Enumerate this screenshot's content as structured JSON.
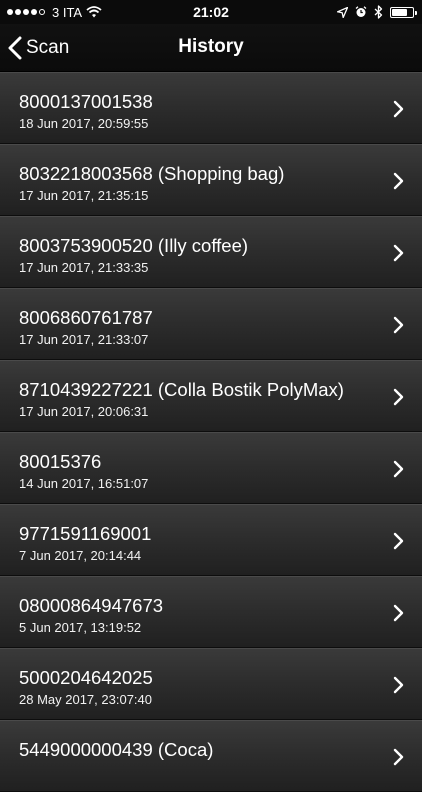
{
  "status_bar": {
    "carrier": "3 ITA",
    "time": "21:02",
    "signal_bars_filled": 4,
    "signal_bars_total": 5,
    "battery_level": 0.75
  },
  "nav": {
    "back_label": "Scan",
    "title": "History"
  },
  "history": [
    {
      "code": "8000137001538",
      "date": "18 Jun 2017, 20:59:55"
    },
    {
      "code": "8032218003568 (Shopping bag)",
      "date": "17 Jun 2017, 21:35:15"
    },
    {
      "code": "8003753900520 (Illy coffee)",
      "date": "17 Jun 2017, 21:33:35"
    },
    {
      "code": "8006860761787",
      "date": "17 Jun 2017, 21:33:07"
    },
    {
      "code": "8710439227221 (Colla Bostik PolyMax)",
      "date": "17 Jun 2017, 20:06:31"
    },
    {
      "code": "80015376",
      "date": "14 Jun 2017, 16:51:07"
    },
    {
      "code": "9771591169001",
      "date": "7 Jun 2017, 20:14:44"
    },
    {
      "code": "08000864947673",
      "date": "5 Jun 2017, 13:19:52"
    },
    {
      "code": "5000204642025",
      "date": "28 May 2017, 23:07:40"
    },
    {
      "code": "5449000000439 (Coca)",
      "date": ""
    }
  ],
  "icons": {
    "back": "chevron-left-icon",
    "row": "chevron-right-icon",
    "wifi": "wifi-icon",
    "location": "location-arrow-icon",
    "alarm": "alarm-clock-icon",
    "bluetooth": "bluetooth-icon",
    "battery": "battery-icon"
  }
}
